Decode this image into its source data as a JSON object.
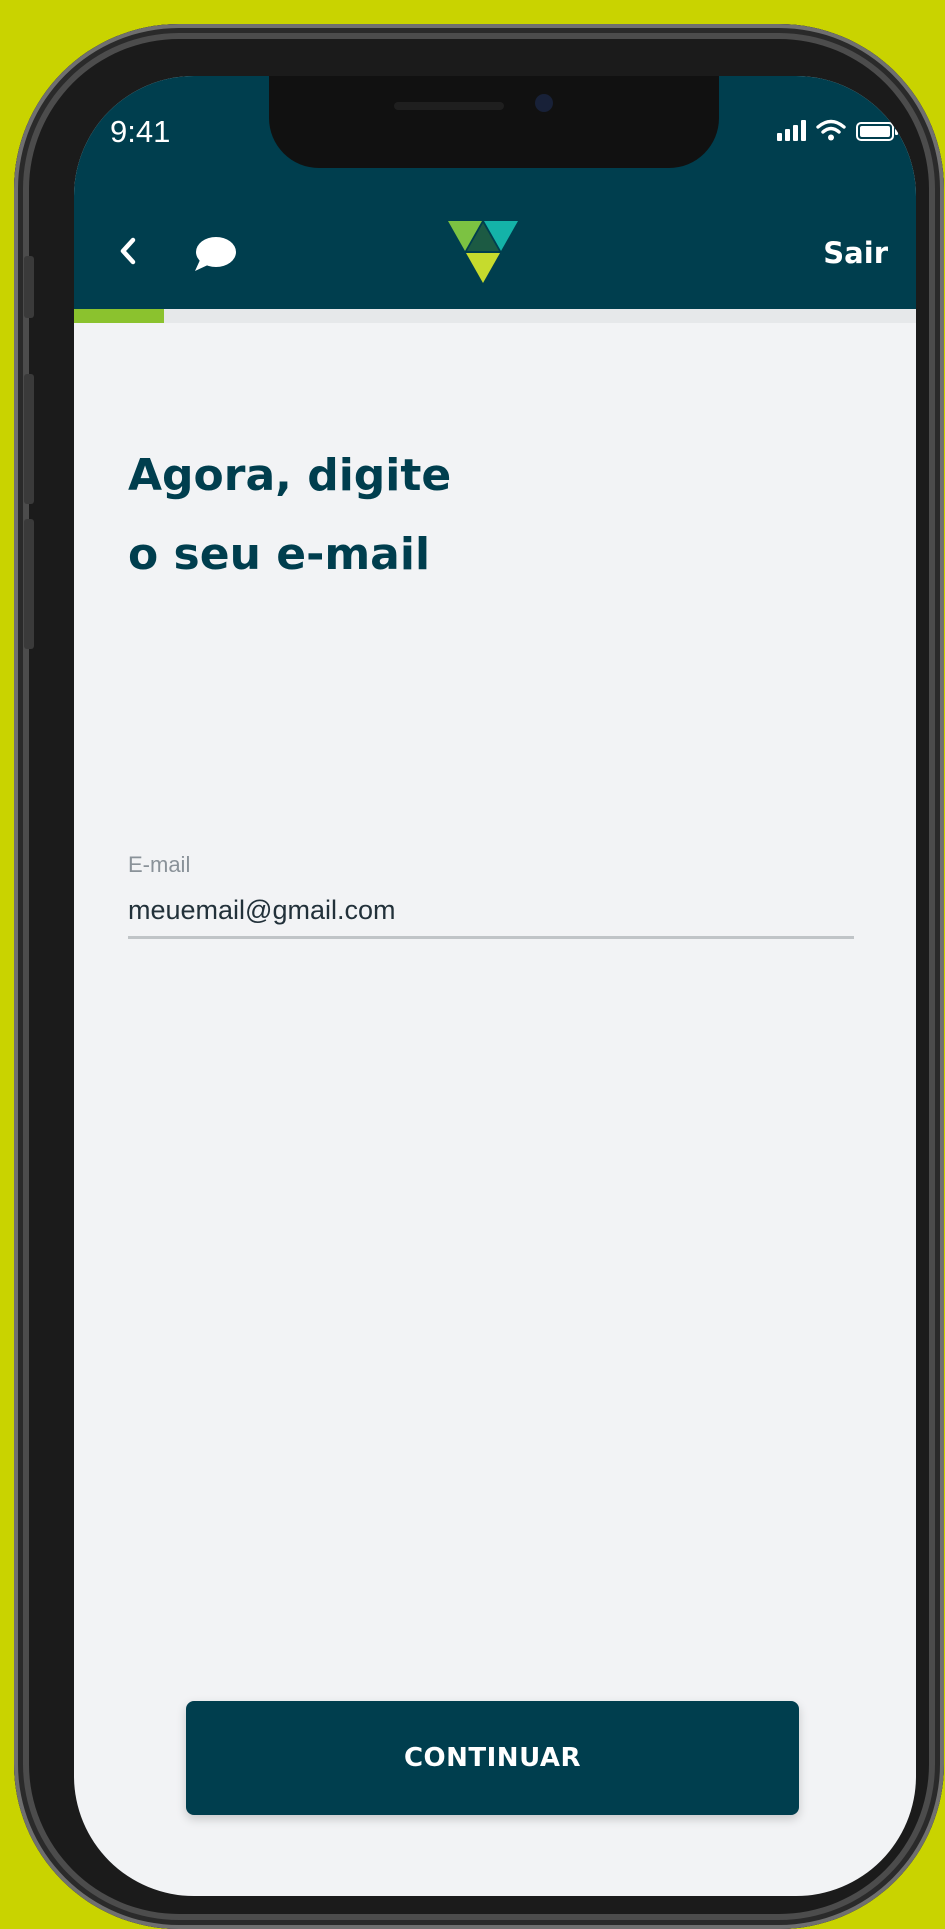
{
  "colors": {
    "background": "#c9d300",
    "header": "#003e4e",
    "accent_green": "#8bc22e",
    "screen": "#f2f3f5"
  },
  "status_bar": {
    "time": "9:41",
    "icons": [
      "signal-icon",
      "wifi-icon",
      "battery-icon"
    ]
  },
  "header": {
    "back_icon": "chevron-left-icon",
    "chat_icon": "chat-bubble-icon",
    "logo": "triangle-logo",
    "exit_label": "Sair"
  },
  "progress": {
    "fraction": 0.107
  },
  "main": {
    "title_line1": "Agora, digite",
    "title_line2": "o seu e-mail"
  },
  "email_field": {
    "label": "E-mail",
    "value": "meuemail@gmail.com"
  },
  "cta": {
    "label": "CONTINUAR"
  }
}
